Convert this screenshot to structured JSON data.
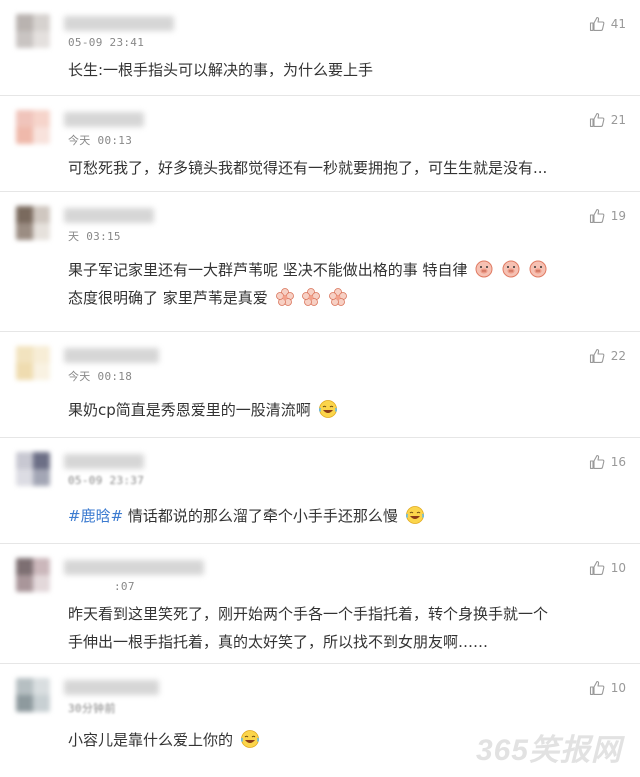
{
  "comments": [
    {
      "time": "05-09 23:41",
      "likes": "41",
      "lines": [
        "长生:一根手指头可以解决的事，为什么要上手"
      ],
      "avatar_colors": [
        "#b9b3b0",
        "#d6d2cf",
        "#c9c4c2",
        "#e4e0de"
      ]
    },
    {
      "time": "今天 00:13",
      "likes": "21",
      "lines": [
        "可愁死我了，好多镜头我都觉得还有一秒就要拥抱了，可生生就是没有..."
      ],
      "avatar_colors": [
        "#f0c4bb",
        "#f6d4cb",
        "#efb9ab",
        "#f8e2dc"
      ]
    },
    {
      "time": "天 03:15",
      "likes": "19",
      "lines": [
        "果子军记家里还有一大群芦苇呢 坚决不能做出格的事 特自律",
        "态度很明确了 家里芦苇是真爱"
      ],
      "avatar_colors": [
        "#7a6a5e",
        "#cfc7c0",
        "#9b8d83",
        "#e6e1dc"
      ]
    },
    {
      "time": "今天 00:18",
      "likes": "22",
      "lines": [
        "果奶cp简直是秀恩爱里的一股清流啊"
      ],
      "avatar_colors": [
        "#f2e3bf",
        "#f7edd6",
        "#efdcb0",
        "#f9f2e2"
      ]
    },
    {
      "time": "05-09 23:37",
      "likes": "16",
      "hashtag": "#鹿晗#",
      "lines": [
        "情话都说的那么溜了牵个小手手还那么慢"
      ],
      "avatar_colors": [
        "#c8c8d2",
        "#6c6f86",
        "#dcdce3",
        "#a3a6b5"
      ]
    },
    {
      "time": ":07",
      "likes": "10",
      "lines": [
        "昨天看到这里笑死了，刚开始两个手各一个手指托着，转个身换手就一个",
        "手伸出一根手指托着，真的太好笑了，所以找不到女朋友啊……"
      ],
      "avatar_colors": [
        "#7d6f72",
        "#cbb7bb",
        "#a9969a",
        "#e3d8da"
      ]
    },
    {
      "time": "30分钟前",
      "likes": "10",
      "lines": [
        "小容儿是靠什么爱上你的"
      ],
      "avatar_colors": [
        "#b6bfc2",
        "#d9dee0",
        "#8e9a9e",
        "#c8d0d3"
      ]
    }
  ],
  "watermark": "365笑报网",
  "colors": {
    "hashtag": "#3c7bd0",
    "text": "#333333",
    "meta": "#999999"
  }
}
